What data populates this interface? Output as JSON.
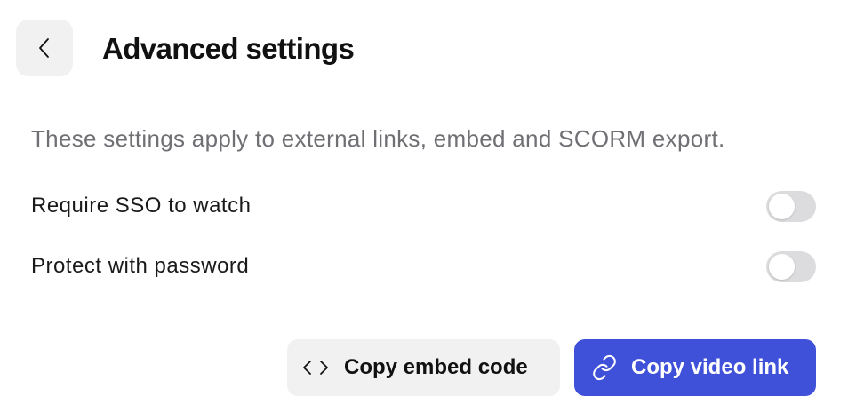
{
  "header": {
    "back_icon": "chevron-left-icon",
    "title": "Advanced settings"
  },
  "description": "These settings apply to external links, embed and SCORM export.",
  "settings": [
    {
      "label": "Require SSO to watch",
      "enabled": false
    },
    {
      "label": "Protect with password",
      "enabled": false
    }
  ],
  "actions": {
    "embed": {
      "label": "Copy embed code",
      "icon": "code-icon"
    },
    "link": {
      "label": "Copy video link",
      "icon": "link-icon"
    }
  },
  "colors": {
    "primary": "#3f51d8",
    "secondary_bg": "#f1f1f2",
    "toggle_off": "#dcdcde",
    "muted_text": "#6f6f74"
  }
}
